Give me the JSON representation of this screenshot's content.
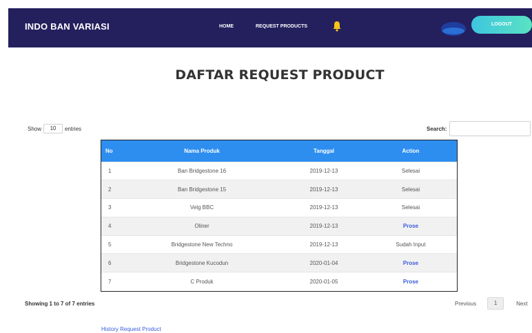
{
  "navbar": {
    "brand": "INDO BAN VARIASI",
    "links": [
      {
        "label": "HOME"
      },
      {
        "label": "REQUEST PRODUCTS"
      }
    ],
    "bell_icon": "bell-icon",
    "logout_label": "LOGOUT",
    "colors": {
      "background": "#24205e",
      "logout_gradient_start": "#3ec6e0",
      "logout_gradient_end": "#59e2c2"
    }
  },
  "page": {
    "title": "DAFTAR REQUEST PRODUCT"
  },
  "controls": {
    "show_label": "Show",
    "entries_value": "10",
    "entries_label": "entries",
    "search_label": "Search:",
    "search_value": ""
  },
  "table": {
    "columns": [
      "No",
      "Nama Produk",
      "Tanggal",
      "Action"
    ],
    "header_color": "#2d8ef0",
    "rows": [
      {
        "no": "1",
        "name": "Ban Bridgestone 16",
        "date": "2019-12-13",
        "action": "Selesai",
        "action_is_link": false
      },
      {
        "no": "2",
        "name": "Ban Bridgestone 15",
        "date": "2019-12-13",
        "action": "Selesai",
        "action_is_link": false
      },
      {
        "no": "3",
        "name": "Velg BBC",
        "date": "2019-12-13",
        "action": "Selesai",
        "action_is_link": false
      },
      {
        "no": "4",
        "name": "Oliner",
        "date": "2019-12-13",
        "action": "Prose",
        "action_is_link": true
      },
      {
        "no": "5",
        "name": "Bridgestone New Techno",
        "date": "2019-12-13",
        "action": "Sudah Input",
        "action_is_link": false
      },
      {
        "no": "6",
        "name": "Bridgestone Kucodun",
        "date": "2020-01-04",
        "action": "Prose",
        "action_is_link": true
      },
      {
        "no": "7",
        "name": "C Produk",
        "date": "2020-01-05",
        "action": "Prose",
        "action_is_link": true
      }
    ]
  },
  "footer": {
    "info": "Showing 1 to 7 of 7 entries",
    "previous": "Previous",
    "current_page": "1",
    "next": "Next",
    "history_link": "History Request Product"
  }
}
